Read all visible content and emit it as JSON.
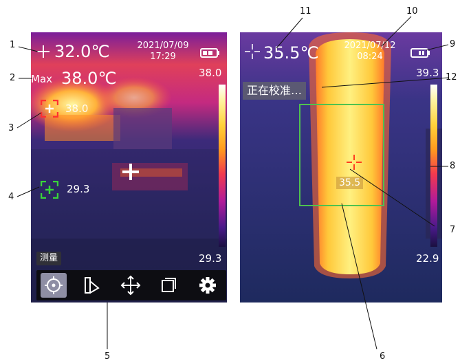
{
  "left_screen": {
    "center_temp": "32.0℃",
    "max_prefix": "Max",
    "max_temp": "38.0℃",
    "date": "2021/07/09",
    "time": "17:29",
    "scale_max": "38.0",
    "scale_min": "29.3",
    "hot_spot_value": "38.0",
    "cold_spot_value": "29.3",
    "mode_label": "测量",
    "toolbar": [
      {
        "icon": "target-icon",
        "active": true
      },
      {
        "icon": "palette-icon",
        "active": false
      },
      {
        "icon": "move-arrows-icon",
        "active": false
      },
      {
        "icon": "layers-icon",
        "active": false
      },
      {
        "icon": "gear-icon",
        "active": false
      }
    ]
  },
  "right_screen": {
    "center_temp": "35.5℃",
    "date": "2021/07/12",
    "time": "08:24",
    "scale_max": "39.3",
    "scale_min": "22.9",
    "calibrating": "正在校准…",
    "box_value": "35.5"
  },
  "callouts": [
    "1",
    "2",
    "3",
    "4",
    "5",
    "6",
    "7",
    "8",
    "9",
    "10",
    "11",
    "12"
  ],
  "colors": {
    "hot_marker": "#ff3030",
    "cold_marker": "#39d639",
    "box_border": "#4fc24f",
    "crosshair": "#ff3c1e"
  }
}
